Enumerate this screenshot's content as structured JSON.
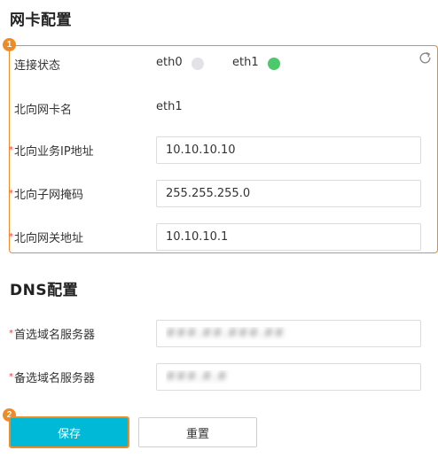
{
  "nic_section": {
    "title": "网卡配置",
    "step_badge": "1",
    "connection_status": {
      "label": "连接状态",
      "interfaces": [
        {
          "name": "eth0",
          "status": "inactive",
          "color": "#e2e3e8"
        },
        {
          "name": "eth1",
          "status": "active",
          "color": "#4cc96b"
        }
      ]
    },
    "northbound_nic_name": {
      "label": "北向网卡名",
      "value": "eth1"
    },
    "northbound_service_ip": {
      "label": "北向业务IP地址",
      "required": "*",
      "value": "10.10.10.10"
    },
    "northbound_subnet_mask": {
      "label": "北向子网掩码",
      "required": "*",
      "value": "255.255.255.0"
    },
    "northbound_gateway": {
      "label": "北向网关地址",
      "required": "*",
      "value": "10.10.10.1"
    },
    "refresh_icon": "refresh-icon"
  },
  "dns_section": {
    "title": "DNS配置",
    "preferred_dns": {
      "label": "首选域名服务器",
      "required": "*",
      "value": "###.##.###.##"
    },
    "alternate_dns": {
      "label": "备选域名服务器",
      "required": "*",
      "value": "###.#.#"
    }
  },
  "actions": {
    "step_badge": "2",
    "save_label": "保存",
    "reset_label": "重置"
  },
  "colors": {
    "accent_orange": "#f08a24",
    "primary_button": "#00b9d6",
    "required_star": "#e64545",
    "status_active": "#4cc96b",
    "status_inactive": "#e2e3e8"
  }
}
